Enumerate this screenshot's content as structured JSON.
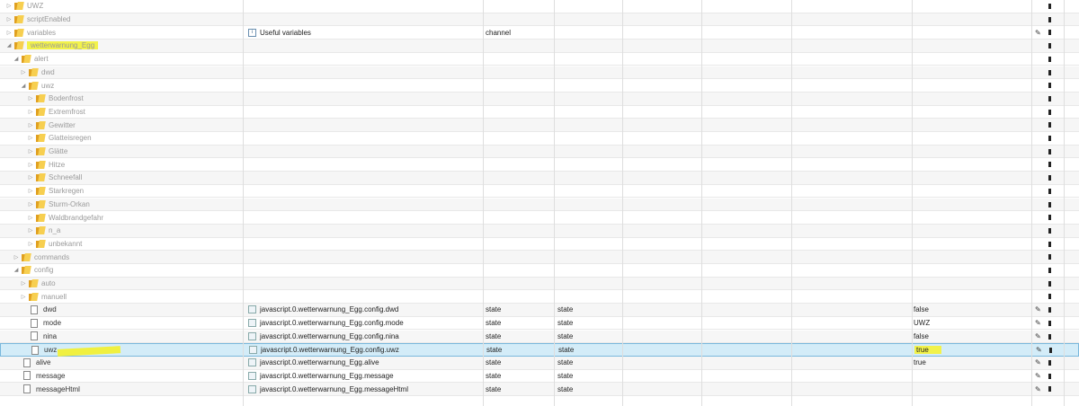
{
  "colors": {
    "folder": "#f7cf50",
    "highlight": "#f2f24a",
    "selected_row": "#d3ecf8"
  },
  "rows": [
    {
      "kind": "folder",
      "expanded": false,
      "level": 0,
      "name": "UWZ"
    },
    {
      "kind": "folder",
      "expanded": false,
      "level": 0,
      "name": "scriptEnabled"
    },
    {
      "kind": "folder",
      "expanded": false,
      "level": 0,
      "name": "variables",
      "id_text": "Useful variables",
      "id_icon": "channel-icon",
      "type": "channel",
      "edit": true
    },
    {
      "kind": "folder",
      "expanded": true,
      "level": 0,
      "name": "wetterwarnung_Egg",
      "highlight": true
    },
    {
      "kind": "folder",
      "expanded": true,
      "level": 1,
      "name": "alert"
    },
    {
      "kind": "folder",
      "expanded": false,
      "level": 2,
      "name": "dwd"
    },
    {
      "kind": "folder",
      "expanded": true,
      "level": 2,
      "name": "uwz"
    },
    {
      "kind": "folder",
      "expanded": false,
      "level": 3,
      "name": "Bodenfrost"
    },
    {
      "kind": "folder",
      "expanded": false,
      "level": 3,
      "name": "Extremfrost"
    },
    {
      "kind": "folder",
      "expanded": false,
      "level": 3,
      "name": "Gewitter"
    },
    {
      "kind": "folder",
      "expanded": false,
      "level": 3,
      "name": "Glatteisregen"
    },
    {
      "kind": "folder",
      "expanded": false,
      "level": 3,
      "name": "Glätte"
    },
    {
      "kind": "folder",
      "expanded": false,
      "level": 3,
      "name": "Hitze"
    },
    {
      "kind": "folder",
      "expanded": false,
      "level": 3,
      "name": "Schneefall"
    },
    {
      "kind": "folder",
      "expanded": false,
      "level": 3,
      "name": "Starkregen"
    },
    {
      "kind": "folder",
      "expanded": false,
      "level": 3,
      "name": "Sturm-Orkan"
    },
    {
      "kind": "folder",
      "expanded": false,
      "level": 3,
      "name": "Waldbrandgefahr"
    },
    {
      "kind": "folder",
      "expanded": false,
      "level": 3,
      "name": "n_a"
    },
    {
      "kind": "folder",
      "expanded": false,
      "level": 3,
      "name": "unbekannt"
    },
    {
      "kind": "folder",
      "expanded": false,
      "level": 1,
      "name": "commands"
    },
    {
      "kind": "folder",
      "expanded": true,
      "level": 1,
      "name": "config"
    },
    {
      "kind": "folder",
      "expanded": false,
      "level": 2,
      "name": "auto"
    },
    {
      "kind": "folder",
      "expanded": false,
      "level": 2,
      "name": "manuell"
    },
    {
      "kind": "file",
      "level": 2,
      "name": "dwd",
      "id_text": "javascript.0.wetterwarnung_Egg.config.dwd",
      "type": "state",
      "role": "state",
      "value": "false",
      "edit": true
    },
    {
      "kind": "file",
      "level": 2,
      "name": "mode",
      "id_text": "javascript.0.wetterwarnung_Egg.config.mode",
      "type": "state",
      "role": "state",
      "value": "UWZ",
      "edit": true
    },
    {
      "kind": "file",
      "level": 2,
      "name": "nina",
      "id_text": "javascript.0.wetterwarnung_Egg.config.nina",
      "type": "state",
      "role": "state",
      "value": "false",
      "edit": true
    },
    {
      "kind": "file",
      "level": 2,
      "name": "uwz",
      "id_text": "javascript.0.wetterwarnung_Egg.config.uwz",
      "type": "state",
      "role": "state",
      "value": "true",
      "edit": true,
      "selected": true,
      "value_highlight": true
    },
    {
      "kind": "file",
      "level": 1,
      "name": "alive",
      "id_text": "javascript.0.wetterwarnung_Egg.alive",
      "type": "state",
      "role": "state",
      "value": "true",
      "edit": true
    },
    {
      "kind": "file",
      "level": 1,
      "name": "message",
      "id_text": "javascript.0.wetterwarnung_Egg.message",
      "type": "state",
      "role": "state",
      "value": "",
      "edit": true
    },
    {
      "kind": "file",
      "level": 1,
      "name": "messageHtml",
      "id_text": "javascript.0.wetterwarnung_Egg.messageHtml",
      "type": "state",
      "role": "state",
      "value": "",
      "edit": true
    }
  ]
}
